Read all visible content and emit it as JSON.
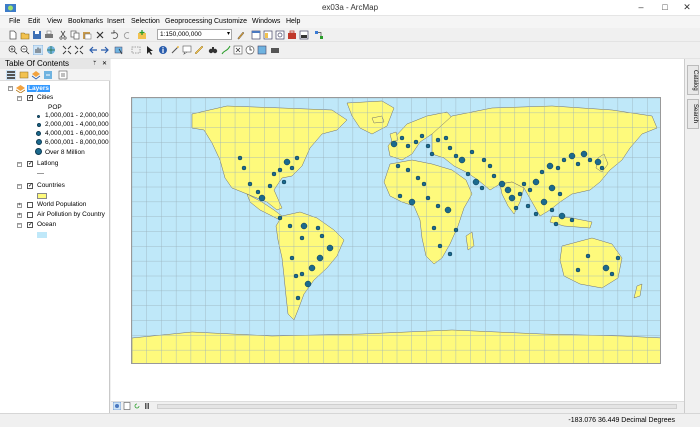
{
  "window": {
    "title": "ex03a - ArcMap",
    "minimize": "–",
    "maximize": "□",
    "close": "✕"
  },
  "menu": [
    "File",
    "Edit",
    "View",
    "Bookmarks",
    "Insert",
    "Selection",
    "Geoprocessing",
    "Customize",
    "Windows",
    "Help"
  ],
  "toolbar": {
    "scale": "1:150,000,000"
  },
  "toc": {
    "title": "Table Of Contents",
    "pin": "ᛘ",
    "close": "✕",
    "layers_group": "Layers",
    "cities": {
      "name": "Cities",
      "field": "POP",
      "classes": [
        "1,000,001 - 2,000,000",
        "2,000,001 - 4,000,000",
        "4,000,001 - 6,000,000",
        "6,000,001 - 8,000,000",
        "Over 8 Million"
      ]
    },
    "latlong": "Latlong",
    "countries": "Countries",
    "world_population": "World Population",
    "air_pollution": "Air Pollution by Country",
    "ocean": "Ocean"
  },
  "dock": {
    "catalog": "Catalog",
    "search": "Search"
  },
  "status": {
    "coords": "-183.076  36.449 Decimal Degrees"
  },
  "colors": {
    "ocean": "#bfe8f9",
    "land": "#fefa7c",
    "city": "#1b6a8e",
    "grid": "#9ab1bd"
  }
}
